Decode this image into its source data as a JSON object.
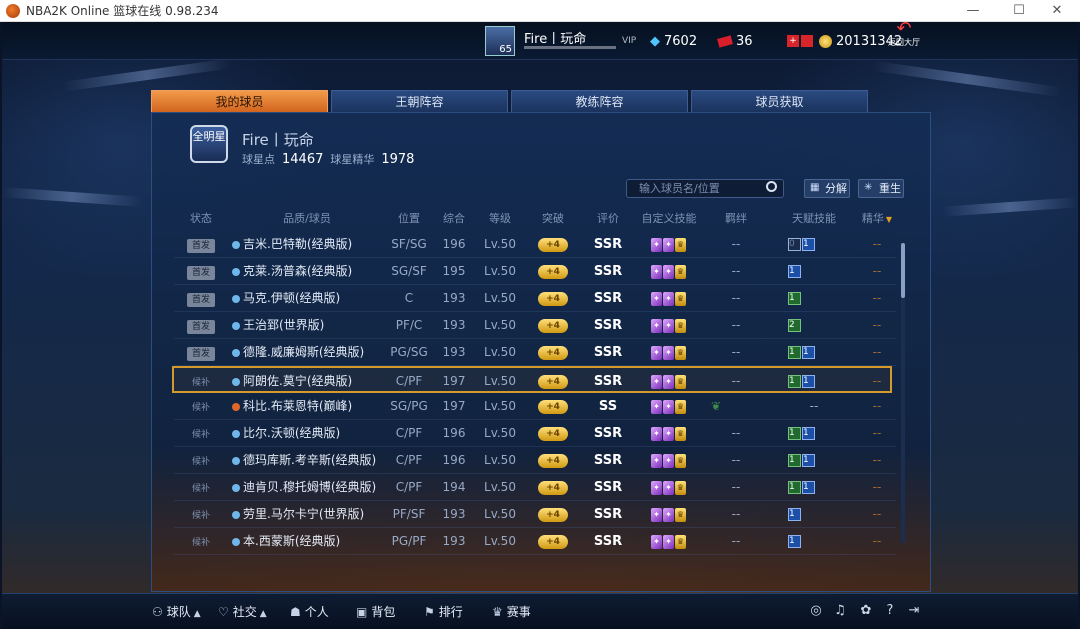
{
  "window": {
    "title": "NBA2K Online 篮球在线 0.98.234",
    "minimize": "—",
    "maximize": "☐",
    "close": "✕"
  },
  "topbar": {
    "level": "65",
    "player_name": "Fire丨玩命",
    "vip_label": "VIP",
    "diamonds": "7602",
    "tickets": "36",
    "coins": "20131342",
    "back_label": "返回大厅",
    "back_arrow": "↶",
    "coin_icon": "coin-icon",
    "ticket_icon": "ticket-icon",
    "gift_icon": "gift-icon"
  },
  "tabs": [
    {
      "label": "我的球员"
    },
    {
      "label": "王朝阵容"
    },
    {
      "label": "教练阵容"
    },
    {
      "label": "球员获取"
    }
  ],
  "profile": {
    "badge": "全明星",
    "name": "Fire丨玩命",
    "points_label": "球星点",
    "points": "14467",
    "essence_label": "球星精华",
    "essence": "1978"
  },
  "toolbar": {
    "search_placeholder": "输入球员名/位置",
    "decompose_label": "分解",
    "rebirth_label": "重生"
  },
  "table": {
    "headers": [
      "状态",
      "品质/球员",
      "位置",
      "综合",
      "等级",
      "突破",
      "评价",
      "自定义技能",
      "羁绊",
      "天赋技能",
      "精华"
    ],
    "sort_arrow": "▼",
    "rows": [
      {
        "status": "首发",
        "name": "吉米.巴特勒(经典版)",
        "position": "SF/SG",
        "overall": "196",
        "level": "Lv.50",
        "break": "+4",
        "rating": "SSR",
        "bond": "--",
        "talents": [
          "0",
          "1"
        ],
        "essence": "--"
      },
      {
        "status": "首发",
        "name": "克莱.汤普森(经典版)",
        "position": "SG/SF",
        "overall": "195",
        "level": "Lv.50",
        "break": "+4",
        "rating": "SSR",
        "bond": "--",
        "talents": [
          "1"
        ],
        "essence": "--"
      },
      {
        "status": "首发",
        "name": "马克.伊顿(经典版)",
        "position": "C",
        "overall": "193",
        "level": "Lv.50",
        "break": "+4",
        "rating": "SSR",
        "bond": "--",
        "talents": [
          "1"
        ],
        "essence": "--"
      },
      {
        "status": "首发",
        "name": "王治郅(世界版)",
        "position": "PF/C",
        "overall": "193",
        "level": "Lv.50",
        "break": "+4",
        "rating": "SSR",
        "bond": "--",
        "talents": [
          "2"
        ],
        "essence": "--"
      },
      {
        "status": "首发",
        "name": "德隆.威廉姆斯(经典版)",
        "position": "PG/SG",
        "overall": "193",
        "level": "Lv.50",
        "break": "+4",
        "rating": "SSR",
        "bond": "--",
        "talents": [
          "1",
          "1"
        ],
        "essence": "--"
      },
      {
        "status": "候补",
        "name": "阿朗佐.莫宁(经典版)",
        "position": "C/PF",
        "overall": "197",
        "level": "Lv.50",
        "break": "+4",
        "rating": "SSR",
        "bond": "--",
        "talents": [
          "1",
          "1"
        ],
        "essence": "--"
      },
      {
        "status": "候补",
        "name": "科比.布莱恩特(巅峰)",
        "position": "SG/PG",
        "overall": "197",
        "level": "Lv.50",
        "break": "+4",
        "rating": "SS",
        "bond": "",
        "talents": [],
        "talents_text": "--",
        "essence": "--"
      },
      {
        "status": "候补",
        "name": "比尔.沃顿(经典版)",
        "position": "C/PF",
        "overall": "196",
        "level": "Lv.50",
        "break": "+4",
        "rating": "SSR",
        "bond": "--",
        "talents": [
          "1",
          "1"
        ],
        "essence": "--"
      },
      {
        "status": "候补",
        "name": "德玛库斯.考辛斯(经典版)",
        "position": "C/PF",
        "overall": "196",
        "level": "Lv.50",
        "break": "+4",
        "rating": "SSR",
        "bond": "--",
        "talents": [
          "1",
          "1"
        ],
        "essence": "--"
      },
      {
        "status": "候补",
        "name": "迪肯贝.穆托姆博(经典版)",
        "position": "C/PF",
        "overall": "194",
        "level": "Lv.50",
        "break": "+4",
        "rating": "SSR",
        "bond": "--",
        "talents": [
          "1",
          "1"
        ],
        "essence": "--"
      },
      {
        "status": "候补",
        "name": "劳里.马尔卡宁(世界版)",
        "position": "PF/SF",
        "overall": "193",
        "level": "Lv.50",
        "break": "+4",
        "rating": "SSR",
        "bond": "--",
        "talents": [
          "1"
        ],
        "essence": "--"
      },
      {
        "status": "候补",
        "name": "本.西蒙斯(经典版)",
        "position": "PG/PF",
        "overall": "193",
        "level": "Lv.50",
        "break": "+4",
        "rating": "SSR",
        "bond": "--",
        "talents": [
          "1"
        ],
        "essence": "--"
      }
    ]
  },
  "bottom": {
    "team": "球队",
    "social": "社交",
    "personal": "个人",
    "bag": "背包",
    "rank": "排行",
    "events": "赛事"
  },
  "colors": {
    "accent": "#d2651e",
    "selected_border": "#d59a2c",
    "ssr": "#ffffff",
    "gold": "#e0b02a"
  }
}
